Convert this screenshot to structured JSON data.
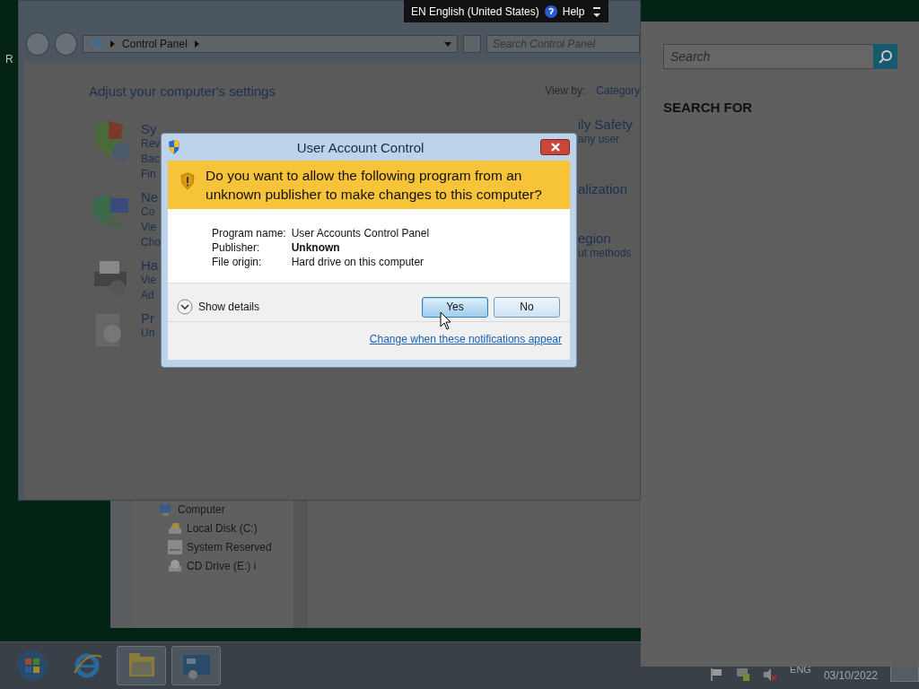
{
  "desktop": {
    "icon_labels": [
      "R"
    ]
  },
  "explorer_window": {
    "tree": [
      {
        "label": "Computer",
        "kind": "computer",
        "children": [
          {
            "label": "Local Disk (C:)",
            "kind": "disk"
          },
          {
            "label": "System Reserved",
            "kind": "drive"
          },
          {
            "label": "CD Drive (E:) i",
            "kind": "cd"
          }
        ]
      }
    ]
  },
  "control_panel": {
    "address": [
      "Control Panel"
    ],
    "search": {
      "placeholder": "Search Control Panel"
    },
    "heading": "Adjust your computer's settings",
    "view_by_label": "View by:",
    "view_by_value": "Category",
    "left_categories": [
      {
        "kind": "shield",
        "title": "Sy",
        "links": [
          "Rev",
          "Bac",
          "Fin"
        ]
      },
      {
        "kind": "network",
        "title": "Ne",
        "links": [
          "Co",
          "Vie",
          "Cho"
        ]
      },
      {
        "kind": "printer",
        "title": "Ha",
        "links": [
          "Vie",
          "Ad"
        ]
      },
      {
        "kind": "programs",
        "title": "Pr",
        "links": [
          "Un"
        ]
      }
    ],
    "right_categories": [
      {
        "title": "ily Safety",
        "links": [
          "any user"
        ]
      },
      {
        "title": "alization"
      },
      {
        "title": "egion",
        "links": [
          "ut methods"
        ]
      }
    ]
  },
  "language_bar": {
    "language": "EN English (United States)",
    "help": "Help"
  },
  "dialog": {
    "title": "User Account Control",
    "question": "Do you want to allow the following program from an unknown publisher to make changes to this computer?",
    "details": [
      {
        "label": "Program name:",
        "value": "User Accounts Control Panel",
        "bold": false
      },
      {
        "label": "Publisher:",
        "value": "Unknown",
        "bold": true
      },
      {
        "label": "File origin:",
        "value": "Hard drive on this computer",
        "bold": false
      }
    ],
    "show_details": "Show details",
    "buttons": [
      {
        "label": "Yes",
        "focused": true
      },
      {
        "label": "No",
        "focused": false
      }
    ],
    "link": "Change when these notifications appear"
  },
  "search_pane": {
    "search": {
      "placeholder": "Search"
    },
    "heading": "SEARCH FOR"
  },
  "taskbar": {
    "buttons": [
      {
        "kind": "start",
        "open": false
      },
      {
        "kind": "browser",
        "open": false
      },
      {
        "kind": "folder",
        "open": true
      },
      {
        "kind": "control-panel",
        "open": true
      }
    ],
    "tray": {
      "language": "ENG",
      "date": "03/10/2022"
    }
  }
}
